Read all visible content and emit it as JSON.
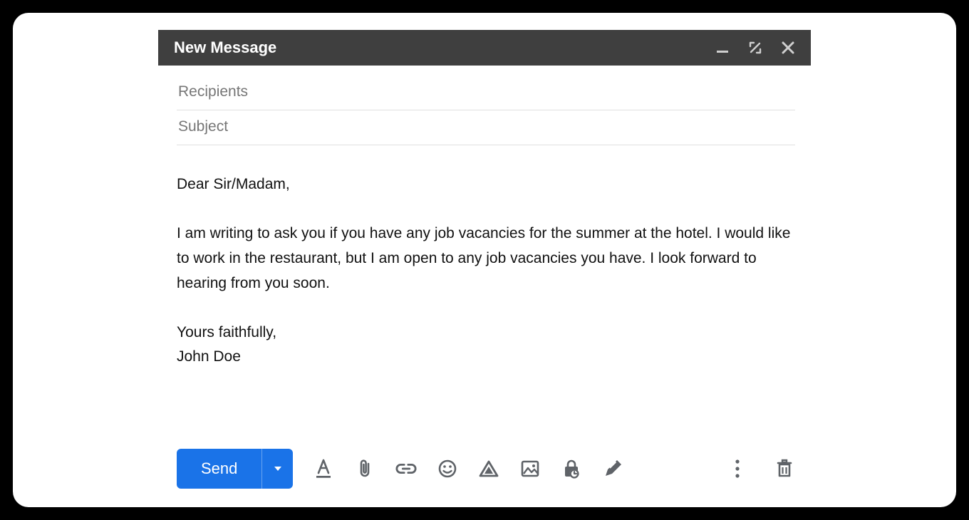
{
  "window": {
    "title": "New Message"
  },
  "fields": {
    "recipients_placeholder": "Recipients",
    "recipients_value": "",
    "subject_placeholder": "Subject",
    "subject_value": ""
  },
  "body": "Dear Sir/Madam,\n\nI am writing to ask you if you have any job vacancies for the summer at the hotel. I would like to work in the restaurant, but I am open to any job vacancies you have. I look forward to hearing from you soon.\n\nYours faithfully,\nJohn Doe",
  "toolbar": {
    "send_label": "Send"
  }
}
